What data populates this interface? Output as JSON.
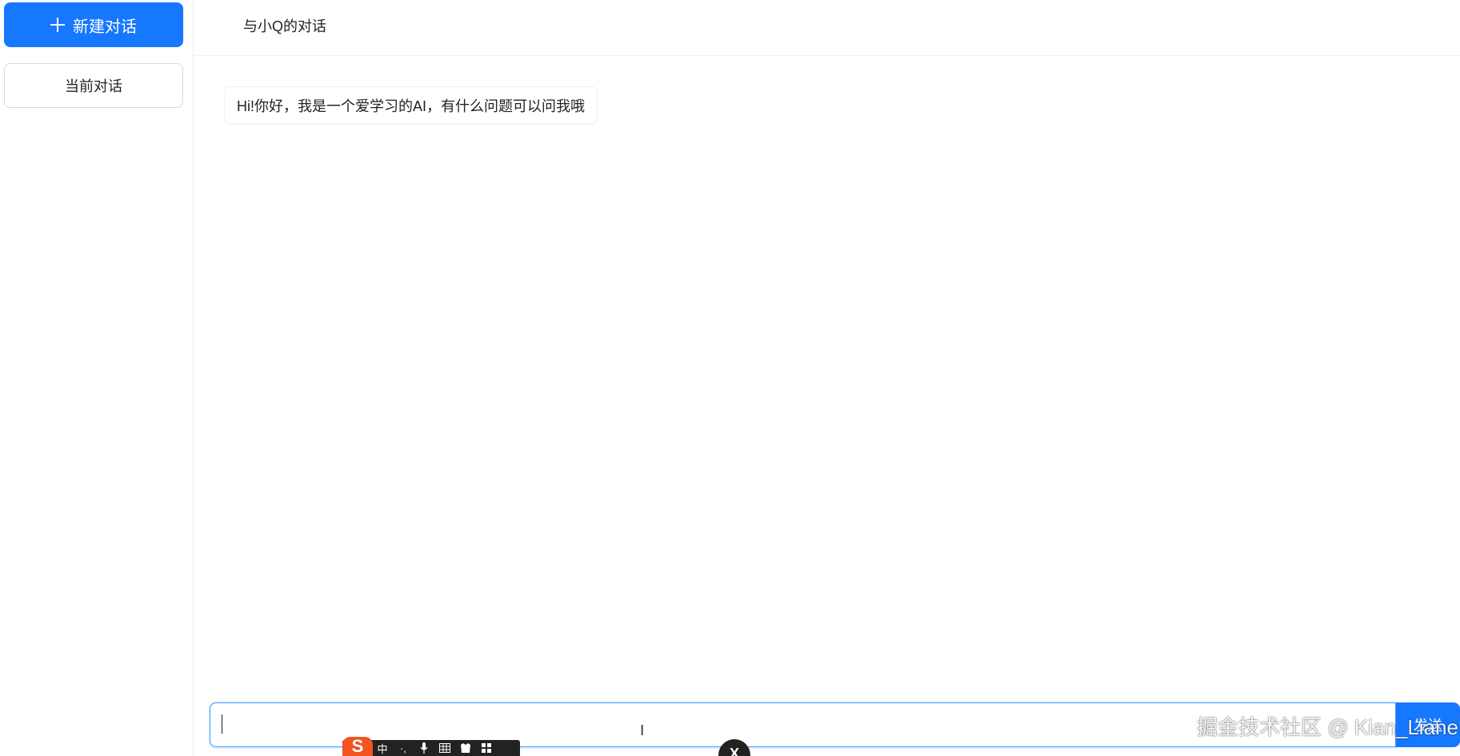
{
  "sidebar": {
    "new_chat_label": "新建对话",
    "conversations": [
      {
        "label": "当前对话"
      }
    ]
  },
  "header": {
    "title": "与小Q的对话"
  },
  "messages": [
    {
      "role": "assistant",
      "text": "Hi!你好，我是一个爱学习的AI，有什么问题可以问我哦"
    }
  ],
  "input": {
    "value": "",
    "send_label": "发送"
  },
  "watermark": "掘金技术社区 @ Kian_Liane",
  "ime_toolbar": {
    "logo": "S",
    "mode": "中"
  },
  "colors": {
    "primary": "#1677ff",
    "border": "#d9d9d9",
    "input_focus_border": "#4096ff"
  }
}
